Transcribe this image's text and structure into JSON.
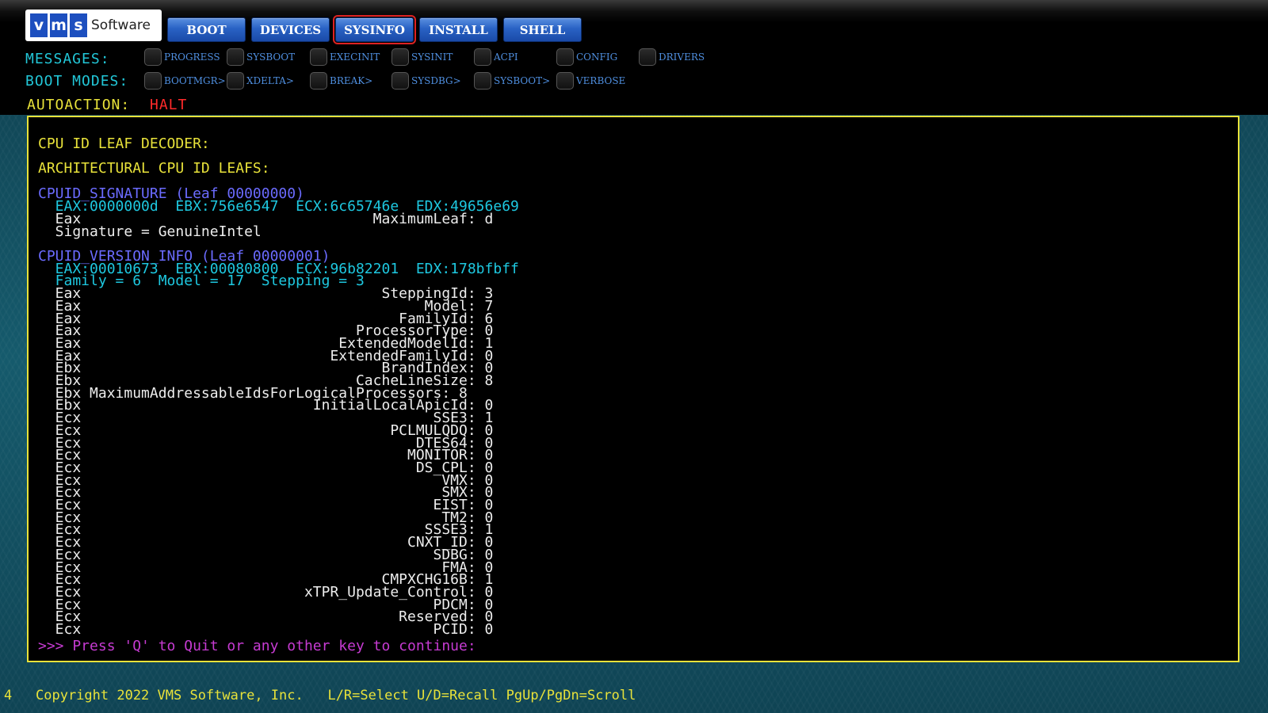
{
  "logo": {
    "letters": [
      "v",
      "m",
      "s"
    ],
    "word": "Software"
  },
  "nav": {
    "buttons": [
      {
        "label": "BOOT",
        "active": false
      },
      {
        "label": "DEVICES",
        "active": false
      },
      {
        "label": "SYSINFO",
        "active": true
      },
      {
        "label": "INSTALL",
        "active": false
      },
      {
        "label": "SHELL",
        "active": false
      }
    ]
  },
  "messages": {
    "label": "MESSAGES:",
    "options": [
      "PROGRESS",
      "SYSBOOT",
      "EXECINIT",
      "SYSINIT",
      "ACPI",
      "CONFIG",
      "DRIVERS"
    ]
  },
  "boot_modes": {
    "label": "BOOT MODES:",
    "options": [
      "BOOTMGR>",
      "XDELTA>",
      "BREAK>",
      "SYSDBG>",
      "SYSBOOT>",
      "VERBOSE"
    ]
  },
  "autoaction": {
    "label": "AUTOACTION:",
    "value": "HALT"
  },
  "console": {
    "lines": [
      {
        "text": "CPU ID LEAF DECODER:",
        "color": "yellow"
      },
      {
        "text": "ARCHITECTURAL CPU ID LEAFS:",
        "color": "yellow"
      },
      {
        "text": "CPUID_SIGNATURE (Leaf 00000000)",
        "color": "violet"
      },
      {
        "text": "  EAX:0000000d  EBX:756e6547  ECX:6c65746e  EDX:49656e69",
        "color": "cyan"
      },
      {
        "text": "  Eax                                  MaximumLeaf: d",
        "color": "white"
      },
      {
        "text": "  Signature = GenuineIntel",
        "color": "white"
      },
      {
        "text": "CPUID_VERSION_INFO (Leaf 00000001)",
        "color": "violet"
      },
      {
        "text": "  EAX:00010673  EBX:00080800  ECX:96b82201  EDX:178bfbff",
        "color": "cyan"
      },
      {
        "text": "  Family = 6  Model = 17  Stepping = 3",
        "color": "cyan"
      },
      {
        "text": "  Eax                                   SteppingId: 3",
        "color": "white"
      },
      {
        "text": "  Eax                                        Model: 7",
        "color": "white"
      },
      {
        "text": "  Eax                                     FamilyId: 6",
        "color": "white"
      },
      {
        "text": "  Eax                                ProcessorType: 0",
        "color": "white"
      },
      {
        "text": "  Eax                              ExtendedModelId: 1",
        "color": "white"
      },
      {
        "text": "  Eax                             ExtendedFamilyId: 0",
        "color": "white"
      },
      {
        "text": "  Ebx                                   BrandIndex: 0",
        "color": "white"
      },
      {
        "text": "  Ebx                                CacheLineSize: 8",
        "color": "white"
      },
      {
        "text": "  Ebx MaximumAddressableIdsForLogicalProcessors: 8",
        "color": "white"
      },
      {
        "text": "  Ebx                           InitialLocalApicId: 0",
        "color": "white"
      },
      {
        "text": "  Ecx                                         SSE3: 1",
        "color": "white"
      },
      {
        "text": "  Ecx                                    PCLMULQDQ: 0",
        "color": "white"
      },
      {
        "text": "  Ecx                                       DTES64: 0",
        "color": "white"
      },
      {
        "text": "  Ecx                                      MONITOR: 0",
        "color": "white"
      },
      {
        "text": "  Ecx                                       DS_CPL: 0",
        "color": "white"
      },
      {
        "text": "  Ecx                                          VMX: 0",
        "color": "white"
      },
      {
        "text": "  Ecx                                          SMX: 0",
        "color": "white"
      },
      {
        "text": "  Ecx                                         EIST: 0",
        "color": "white"
      },
      {
        "text": "  Ecx                                          TM2: 0",
        "color": "white"
      },
      {
        "text": "  Ecx                                        SSSE3: 1",
        "color": "white"
      },
      {
        "text": "  Ecx                                      CNXT_ID: 0",
        "color": "white"
      },
      {
        "text": "  Ecx                                         SDBG: 0",
        "color": "white"
      },
      {
        "text": "  Ecx                                          FMA: 0",
        "color": "white"
      },
      {
        "text": "  Ecx                                   CMPXCHG16B: 1",
        "color": "white"
      },
      {
        "text": "  Ecx                          xTPR_Update_Control: 0",
        "color": "white"
      },
      {
        "text": "  Ecx                                         PDCM: 0",
        "color": "white"
      },
      {
        "text": "  Ecx                                     Reserved: 0",
        "color": "white"
      },
      {
        "text": "  Ecx                                         PCID: 0",
        "color": "white"
      }
    ],
    "prompt": ">>> Press 'Q' to Quit or any other key to continue:"
  },
  "status": {
    "number": "4",
    "text": "Copyright 2022 VMS Software, Inc.   L/R=Select U/D=Recall PgUp/PgDn=Scroll"
  }
}
